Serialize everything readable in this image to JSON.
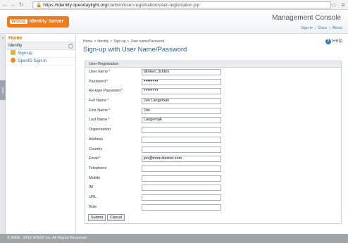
{
  "browser": {
    "url_host": "https://identity.opendaylight.org",
    "url_path": "/carbon/user-registration/user-registration.jsp",
    "icons": {
      "back": "back-arrow-icon",
      "forward": "forward-arrow-icon",
      "reload": "reload-icon",
      "star": "star-icon",
      "menu": "menu-icon"
    }
  },
  "header": {
    "logo_brand": "WSO2",
    "logo_product": "Identity Server",
    "console_title": "Management Console",
    "links": [
      "Sign-in",
      "Docs",
      "About"
    ]
  },
  "rail": {
    "main_tab": "Main"
  },
  "sidebar": {
    "home": "Home",
    "section": "Identity",
    "items": [
      {
        "label": "Sign-up",
        "icon": "signup-icon"
      },
      {
        "label": "OpenID Sign-in",
        "icon": "openid-icon"
      }
    ]
  },
  "main": {
    "breadcrumb": [
      "Home",
      "Identity",
      "Sign-up",
      "User name/Password"
    ],
    "title": "Sign-up with User Name/Password",
    "help": "Help"
  },
  "form": {
    "legend": "User Registration",
    "fields": [
      {
        "label": "User name",
        "required": true,
        "value": "blinken_lichten"
      },
      {
        "label": "Password",
        "required": true,
        "value": "••••••••"
      },
      {
        "label": "Re-type Password",
        "required": true,
        "value": "••••••••"
      },
      {
        "label": "Full Name",
        "required": true,
        "value": "Jon Langemak"
      },
      {
        "label": "First Name",
        "required": true,
        "value": "Jon"
      },
      {
        "label": "Last Name",
        "required": true,
        "value": "Langemak"
      },
      {
        "label": "Organization",
        "required": false,
        "value": ""
      },
      {
        "label": "Address",
        "required": false,
        "value": ""
      },
      {
        "label": "Country",
        "required": false,
        "value": ""
      },
      {
        "label": "Email",
        "required": true,
        "value": "jon@interubernet.com"
      },
      {
        "label": "Telephone",
        "required": false,
        "value": ""
      },
      {
        "label": "Mobile",
        "required": false,
        "value": ""
      },
      {
        "label": "IM",
        "required": false,
        "value": ""
      },
      {
        "label": "URL",
        "required": false,
        "value": ""
      },
      {
        "label": "Role",
        "required": false,
        "value": ""
      }
    ],
    "submit": "Submit",
    "cancel": "Cancel"
  },
  "footer": {
    "text": "© 2008 - 2012 WSO2 Inc. All Rights Reserved."
  },
  "colors": {
    "accent": "#f07a1c",
    "link": "#2f6fa3",
    "title": "#2f5f8f",
    "required": "#dd2222"
  }
}
